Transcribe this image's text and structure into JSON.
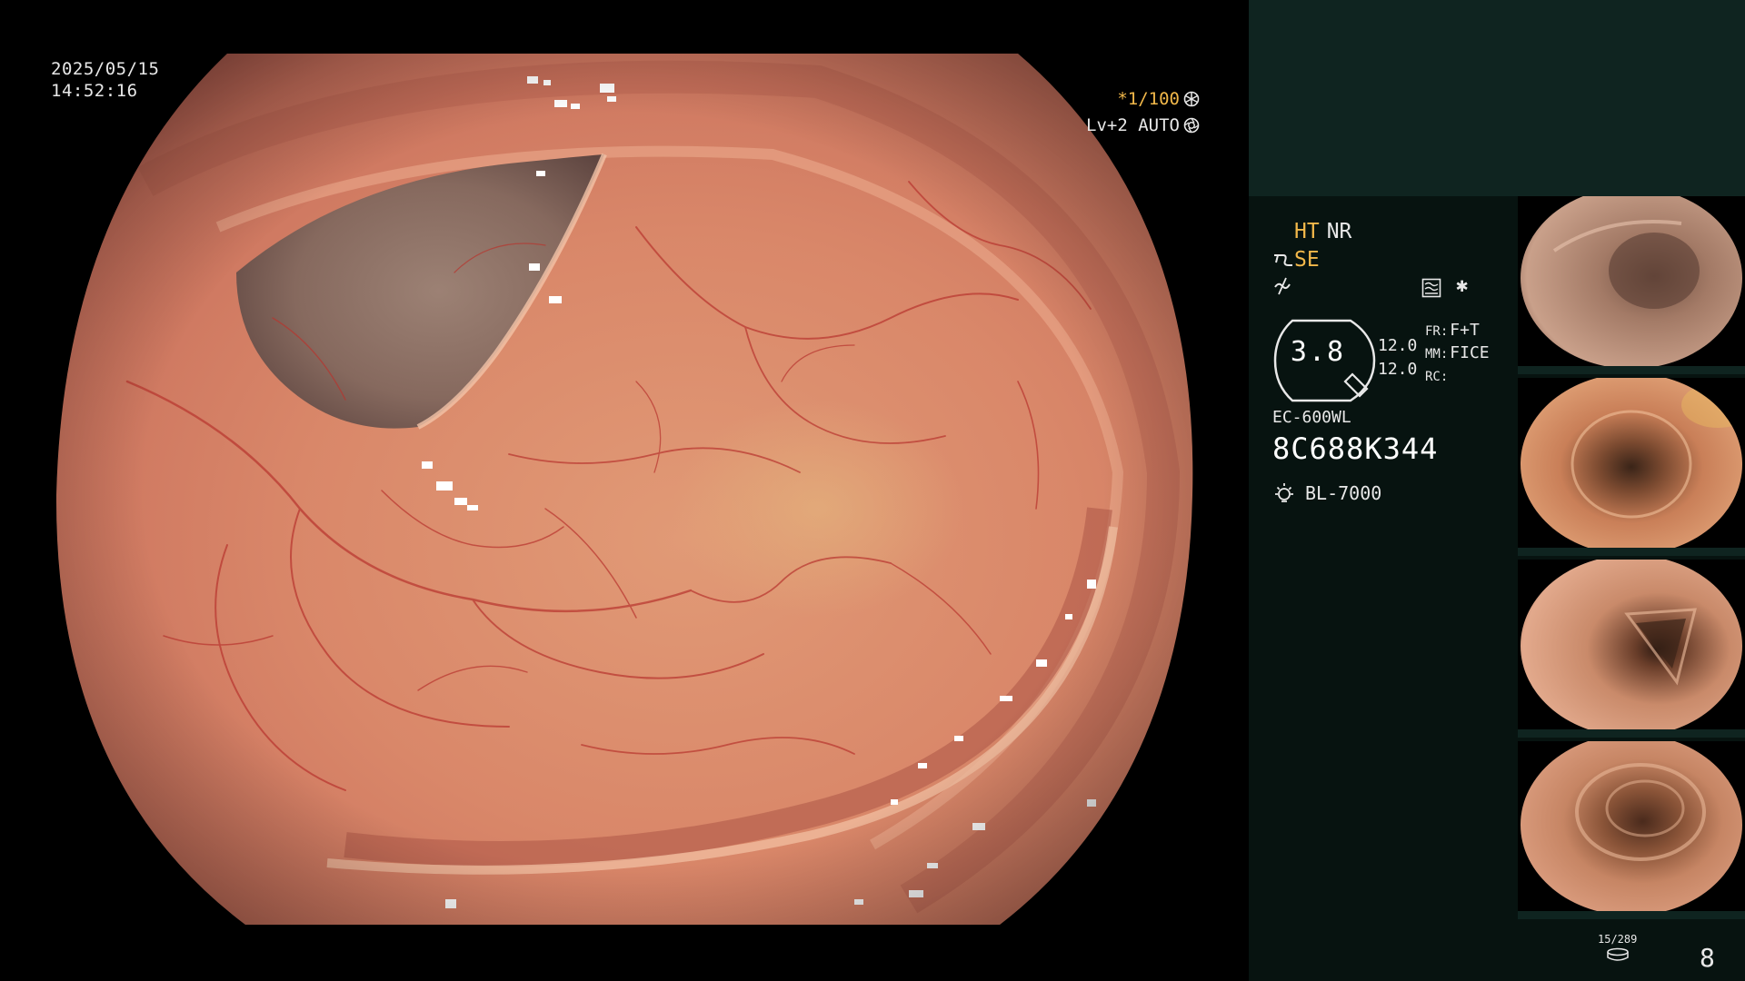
{
  "image_info": {
    "date": "2025/05/15",
    "time": "14:52:16"
  },
  "exposure": {
    "shutter": "*1/100",
    "iris": "Lv+2 AUTO"
  },
  "processing": {
    "ht": "HT",
    "nr": "NR",
    "se": "SE"
  },
  "zoom": {
    "value": "3.8"
  },
  "parameters": {
    "values": [
      "12.0",
      "12.0"
    ],
    "fr_label": "FR:",
    "fr_value": "F+T",
    "mm_label": "MM:",
    "mm_value": "FICE",
    "rc_label": "RC:"
  },
  "scope": {
    "model": "EC-600WL",
    "serial": "8C688K344"
  },
  "light_source": {
    "model": "BL-7000"
  },
  "media": {
    "counter": "15/289",
    "page": "8"
  },
  "icons": {
    "shutter": "snowflake-icon",
    "iris": "iris-icon",
    "se": "scope-curve-icon",
    "tilde": "edge-enhance-icon",
    "wave": "color-mode-icon",
    "light": "light-bulb-icon",
    "media": "disk-icon"
  },
  "colors": {
    "accent": "#f2b84a",
    "panel_bg": "#071310",
    "panel_top": "#0f2420",
    "text": "#e8e8e8"
  }
}
